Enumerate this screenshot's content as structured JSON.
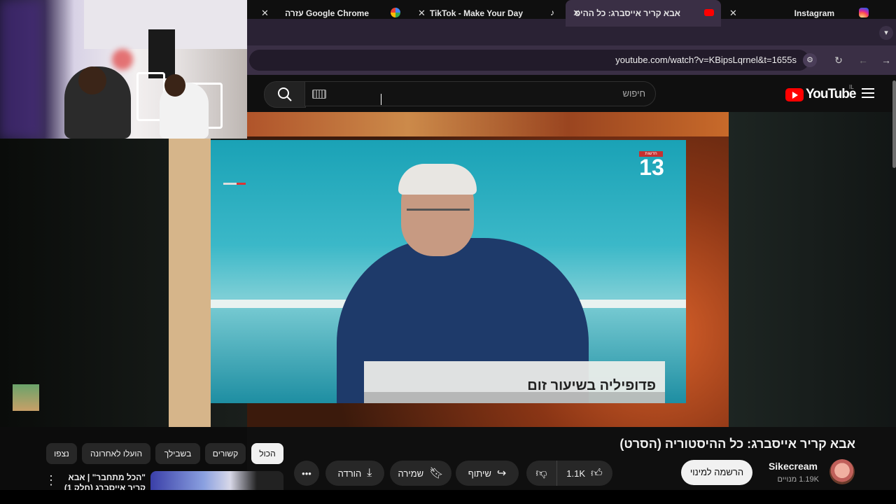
{
  "tabs": [
    {
      "title": "Google Chrome עזרה",
      "favicon": "google-g-icon",
      "active": false
    },
    {
      "title": "TikTok - Make Your Day",
      "favicon": "tiktok-icon",
      "active": false
    },
    {
      "title": "אבא קריר אייסברג: כל ההיס",
      "favicon": "youtube-icon",
      "active": true
    },
    {
      "title": "Instagram",
      "favicon": "instagram-icon",
      "active": false
    }
  ],
  "address": {
    "url": "youtube.com/watch?v=KBipsLqrnel&t=1655s"
  },
  "youtube": {
    "logo_text": "YouTube",
    "country_code": "IL",
    "search_placeholder": "חיפוש"
  },
  "video": {
    "channel_logo": "13",
    "channel_logo_caption": "חדשות",
    "lower_third": "פדופיליה בשיעור זום"
  },
  "meta": {
    "title": "אבא קריר אייסברג: כל ההיסטוריה (הסרט)",
    "channel_name": "Sikecream",
    "subscribers": "1.19K מנויים",
    "subscribe_label": "הרשמה למינוי",
    "like_count": "1.1K",
    "share_label": "שיתוף",
    "save_label": "שמירה",
    "download_label": "הורדה",
    "more_label": "•••"
  },
  "chips": {
    "all": "הכול",
    "related": "קשורים",
    "for_you": "בשבילך",
    "recent": "הועלו לאחרונה",
    "watched": "נצפו"
  },
  "sidebar": {
    "video_title_line1": "\"הכל מתחבר\" | אבא",
    "video_title_line2": "קריר אייסברג (חלק 1)"
  },
  "colors": {
    "accent": "#ff0000",
    "tabstrip": "#2a2234",
    "background": "#0f0f0f"
  }
}
